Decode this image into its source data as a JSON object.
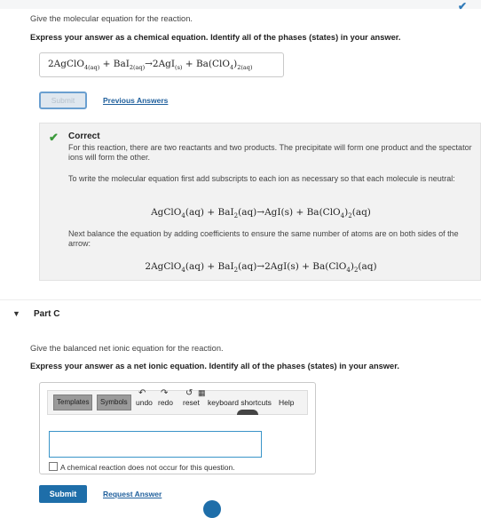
{
  "part_b": {
    "instruction": "Give the molecular equation for the reaction.",
    "bold_instruction": "Express your answer as a chemical equation. Identify all of the phases (states) in your answer.",
    "answer": {
      "p1": "2AgClO",
      "s1": "4(aq)",
      "p2": " + BaI",
      "s2": "2(aq)",
      "p3": "→2AgI",
      "s3": "(s)",
      "p4": " + Ba(ClO",
      "s4": "4",
      "p5": ")",
      "s5": "2(aq)"
    },
    "submit_label": "Submit",
    "previous_answers_label": "Previous Answers"
  },
  "feedback": {
    "title": "Correct",
    "p1": "For this reaction, there are two reactants and two products. The precipitate will form one product and the spectator ions will form the other.",
    "p2": "To write the molecular equation first add subscripts to each ion as necessary so that each molecule is neutral:",
    "eq1": {
      "a": "AgClO",
      "b": "4",
      "c": "(aq) + BaI",
      "d": "2",
      "e": "(aq)→AgI(s) + Ba(ClO",
      "f": "4",
      "g": ")",
      "h": "2",
      "i": "(aq)"
    },
    "p3": "Next balance the equation by adding coefficients to ensure the same number of atoms are on both sides of the arrow:",
    "eq2": {
      "a": "2AgClO",
      "b": "4",
      "c": "(aq) + BaI",
      "d": "2",
      "e": "(aq)→2AgI(s) + Ba(ClO",
      "f": "4",
      "g": ")",
      "h": "2",
      "i": "(aq)"
    }
  },
  "part_c": {
    "title": "Part C",
    "instruction": "Give the balanced net ionic equation for the reaction.",
    "bold_instruction": "Express your answer as a net ionic equation. Identify all of the phases (states) in your answer.",
    "toolbar": {
      "templates": "Templates",
      "symbols": "Symbols",
      "undo": "undo",
      "redo": "redo",
      "reset": "reset",
      "shortcuts": "keyboard shortcuts",
      "help": "Help"
    },
    "no_reaction_label": "A chemical reaction does not occur for this question.",
    "submit_label": "Submit",
    "request_answer_label": "Request Answer"
  },
  "colors": {
    "accent": "#1e6ea9",
    "success": "#3b9a3b",
    "link": "#1f5f9c"
  },
  "icons": [
    "checkmark-icon",
    "caret-down-icon",
    "undo-icon",
    "redo-icon",
    "reset-icon",
    "keyboard-icon"
  ]
}
